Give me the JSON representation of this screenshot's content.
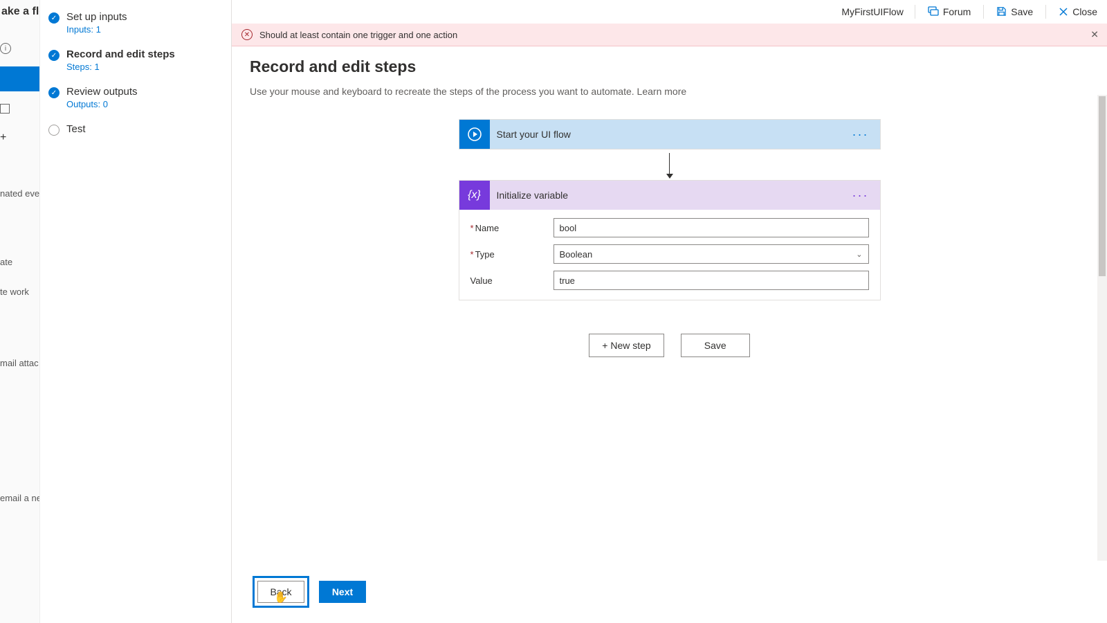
{
  "leftSlice": {
    "titleFrag": "ake a flo",
    "textFrags": [
      "nated even",
      "ate",
      "te work",
      "mail attac",
      "email a ne"
    ]
  },
  "wizard": {
    "steps": [
      {
        "title": "Set up inputs",
        "sub": "Inputs: 1",
        "done": true,
        "active": false
      },
      {
        "title": "Record and edit steps",
        "sub": "Steps: 1",
        "done": true,
        "active": true
      },
      {
        "title": "Review outputs",
        "sub": "Outputs: 0",
        "done": true,
        "active": false
      },
      {
        "title": "Test",
        "done": false,
        "active": false
      }
    ]
  },
  "topBar": {
    "flowName": "MyFirstUIFlow",
    "forum": "Forum",
    "save": "Save",
    "close": "Close"
  },
  "banner": {
    "message": "Should at least contain one trigger and one action"
  },
  "page": {
    "heading": "Record and edit steps",
    "subhead": "Use your mouse and keyboard to recreate the steps of the process you want to automate.  ",
    "learnMore": "Learn more"
  },
  "cards": {
    "start": {
      "title": "Start your UI flow"
    },
    "init": {
      "title": "Initialize variable",
      "fields": {
        "nameLabel": "Name",
        "nameValue": "bool",
        "typeLabel": "Type",
        "typeValue": "Boolean",
        "valueLabel": "Value",
        "valueValue": "true"
      }
    }
  },
  "actions": {
    "newStep": "+  New step",
    "save": "Save"
  },
  "bottom": {
    "back": "Back",
    "next": "Next"
  }
}
